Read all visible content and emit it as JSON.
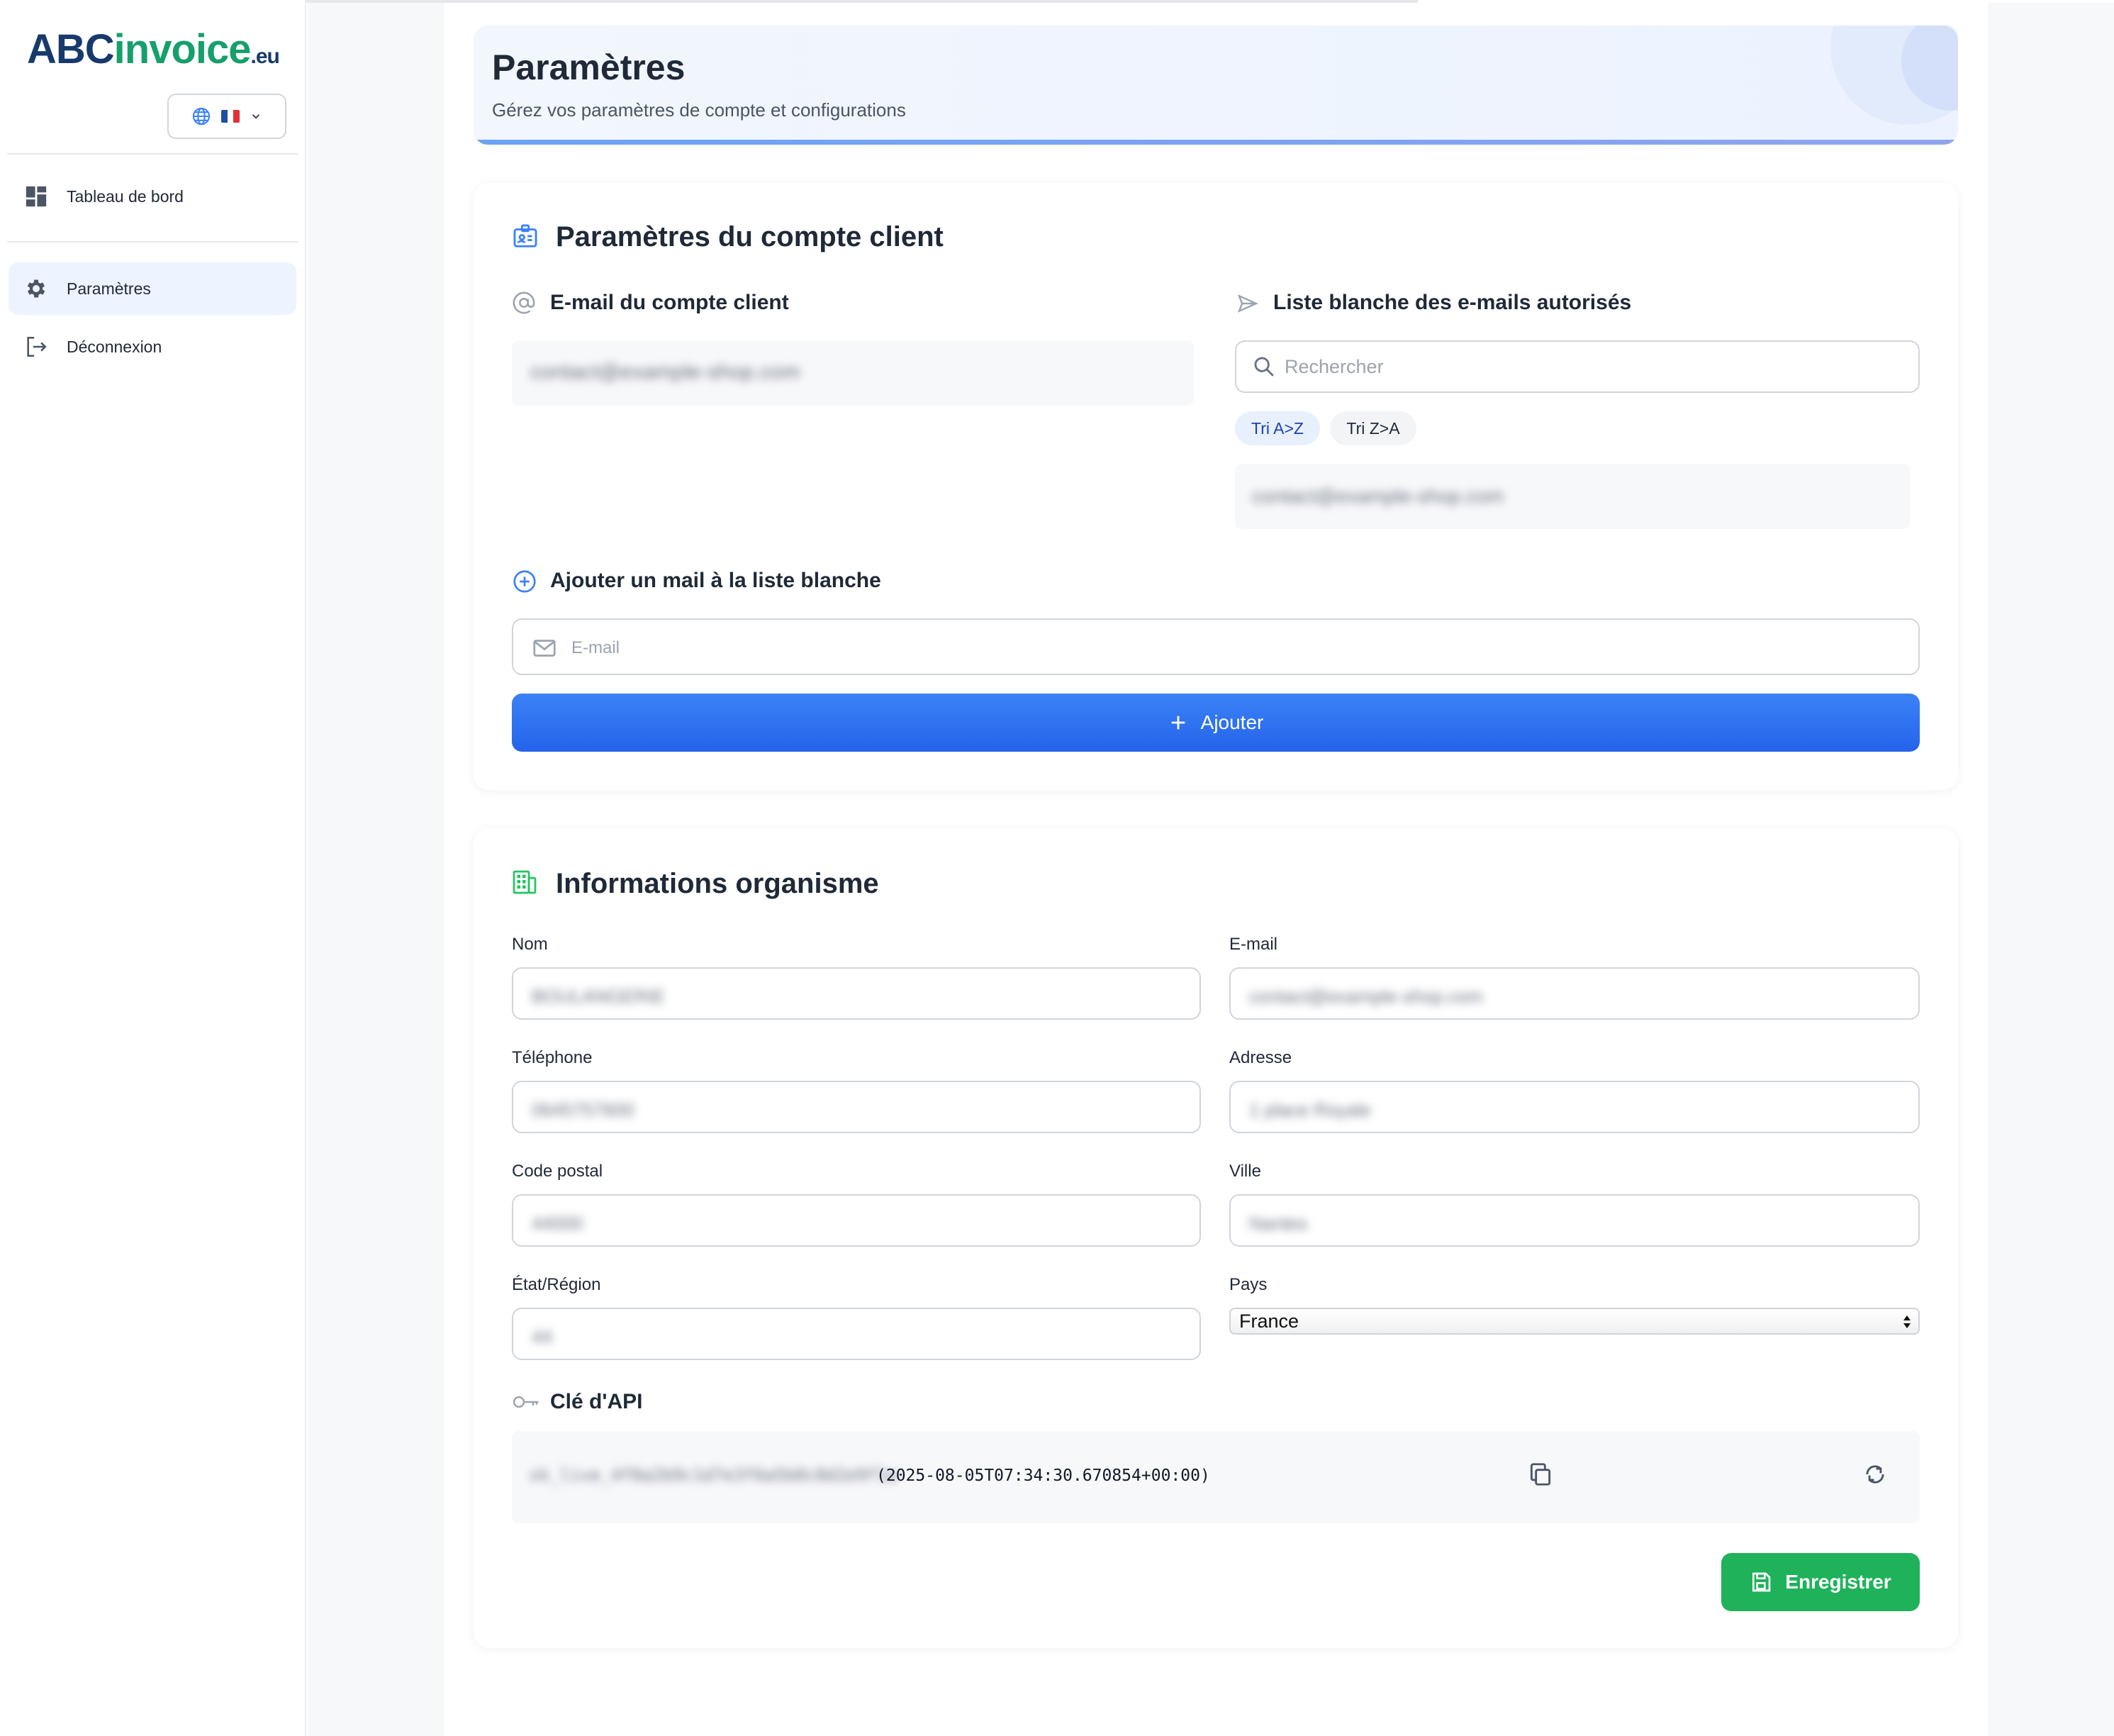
{
  "brand": {
    "abc": "ABC",
    "invoice": "invoice",
    "tld": ".eu"
  },
  "language": {
    "icon": "globe-icon",
    "flag": "flag-fr",
    "flag_colors": [
      "#1e4fa0",
      "#ffffff",
      "#e0303a"
    ]
  },
  "sidebar": {
    "items": [
      {
        "label": "Tableau de bord",
        "icon": "dashboard-icon"
      },
      {
        "label": "Paramètres",
        "icon": "gear-icon",
        "active": true
      },
      {
        "label": "Déconnexion",
        "icon": "logout-icon"
      }
    ]
  },
  "header": {
    "title": "Paramètres",
    "subtitle": "Gérez vos paramètres de compte et configurations"
  },
  "account": {
    "title": "Paramètres du compte client",
    "email_section_title": "E-mail du compte client",
    "email_value": "contact@example-shop.com",
    "whitelist_title": "Liste blanche des e-mails autorisés",
    "search_placeholder": "Rechercher",
    "sort_az": "Tri A>Z",
    "sort_za": "Tri Z>A",
    "whitelist_items": [
      "contact@example-shop.com"
    ],
    "add_title": "Ajouter un mail à la liste blanche",
    "add_placeholder": "E-mail",
    "add_button": "Ajouter"
  },
  "org": {
    "title": "Informations organisme",
    "fields": {
      "nom": {
        "label": "Nom",
        "value": "BOULANGERIE"
      },
      "email": {
        "label": "E-mail",
        "value": "contact@example-shop.com"
      },
      "telephone": {
        "label": "Téléphone",
        "value": "0645757600"
      },
      "adresse": {
        "label": "Adresse",
        "value": "1 place Royale"
      },
      "code_postal": {
        "label": "Code postal",
        "value": "44000"
      },
      "ville": {
        "label": "Ville",
        "value": "Nantes"
      },
      "region": {
        "label": "État/Région",
        "value": "44"
      },
      "pays": {
        "label": "Pays",
        "value": "France"
      }
    },
    "api_title": "Clé d'API",
    "api_key": "sk_live_4f8a2b9c1d7e3f6a5b0c8d2e9f1a",
    "api_timestamp": "(2025-08-05T07:34:30.670854+00:00)",
    "save_button": "Enregistrer"
  },
  "colors": {
    "primary": "#2563eb",
    "success": "#1fb25a",
    "brand_dark": "#173a6b",
    "brand_green": "#16a06b"
  }
}
